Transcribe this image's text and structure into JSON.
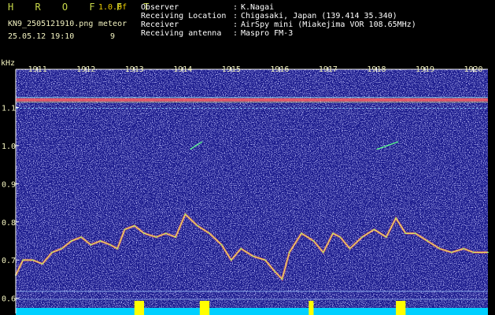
{
  "header": {
    "app_title": "H R O F F T",
    "version": "1.0.0f",
    "filename": "KN9_2505121910.png",
    "meteor_label": "meteor",
    "datetime": "25.05.12 19:10",
    "meteor_count": "9",
    "fields": [
      {
        "label": "Observer",
        "value": "K.Nagai"
      },
      {
        "label": "Receiving Location",
        "value": "Chigasaki, Japan (139.414 35.340)"
      },
      {
        "label": "Receiver",
        "value": "AirSpy mini (Miakejima VOR 108.65MHz)"
      },
      {
        "label": "Receiving antenna",
        "value": "Maspro FM-3"
      }
    ]
  },
  "chart_data": {
    "type": "heatmap",
    "ylabel": "kHz",
    "x_ticks": [
      "1911",
      "1912",
      "1913",
      "1914",
      "1915",
      "1916",
      "1917",
      "1918",
      "1919",
      "1920"
    ],
    "y_ticks": [
      "1.1",
      "1.0",
      "0.9",
      "0.8",
      "0.7",
      "0.6"
    ],
    "ylim": [
      0.56,
      1.2
    ],
    "carrier_khz": 1.12,
    "drift_trace": {
      "x": [
        1910.55,
        1910.7,
        1910.9,
        1911.1,
        1911.3,
        1911.5,
        1911.7,
        1911.9,
        1912.1,
        1912.3,
        1912.5,
        1912.65,
        1912.8,
        1913.0,
        1913.2,
        1913.45,
        1913.65,
        1913.85,
        1914.05,
        1914.3,
        1914.55,
        1914.8,
        1915.0,
        1915.2,
        1915.45,
        1915.7,
        1915.9,
        1916.05,
        1916.2,
        1916.45,
        1916.7,
        1916.9,
        1917.1,
        1917.25,
        1917.45,
        1917.7,
        1917.95,
        1918.2,
        1918.4,
        1918.6,
        1918.8,
        1919.05,
        1919.3,
        1919.55,
        1919.8,
        1920.0,
        1920.3
      ],
      "y": [
        0.66,
        0.7,
        0.7,
        0.69,
        0.72,
        0.73,
        0.75,
        0.76,
        0.74,
        0.75,
        0.74,
        0.73,
        0.78,
        0.79,
        0.77,
        0.76,
        0.77,
        0.76,
        0.82,
        0.79,
        0.77,
        0.74,
        0.7,
        0.73,
        0.71,
        0.7,
        0.67,
        0.65,
        0.72,
        0.77,
        0.75,
        0.72,
        0.77,
        0.76,
        0.73,
        0.76,
        0.78,
        0.76,
        0.81,
        0.77,
        0.77,
        0.75,
        0.73,
        0.72,
        0.73,
        0.72,
        0.72
      ]
    },
    "meteor_echoes": [
      {
        "x": 1913.0,
        "x_end": 1913.2,
        "y": 0.0
      },
      {
        "x": 1914.35,
        "x_end": 1914.55,
        "y": 0.0
      },
      {
        "x": 1916.6,
        "x_end": 1916.7,
        "y": 0.0
      },
      {
        "x": 1918.4,
        "x_end": 1918.6,
        "y": 0.0
      }
    ],
    "streaks": [
      {
        "x": [
          1914.15,
          1914.4
        ],
        "y": [
          0.99,
          1.01
        ]
      },
      {
        "x": [
          1918.0,
          1918.45
        ],
        "y": [
          0.99,
          1.01
        ]
      }
    ],
    "colors": {
      "background_noise": "#1a1a8c",
      "carrier": "#ff6060",
      "trace": "#f0e060",
      "timing_signal": "#00d0ff",
      "meteor": "#ffff00"
    }
  }
}
